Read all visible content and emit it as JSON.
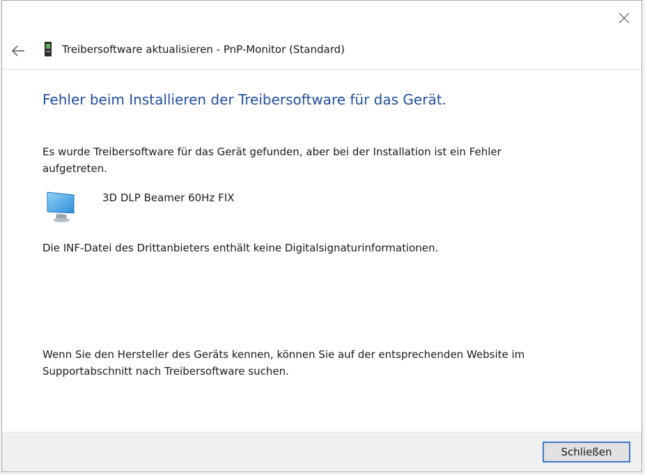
{
  "header": {
    "title": "Treibersoftware aktualisieren - PnP-Monitor (Standard)"
  },
  "content": {
    "heading": "Fehler beim Installieren der Treibersoftware für das Gerät.",
    "message": "Es wurde Treibersoftware für das Gerät gefunden, aber bei der Installation ist ein Fehler aufgetreten.",
    "device_name": "3D DLP Beamer 60Hz FIX",
    "detail": "Die INF-Datei des Drittanbieters enthält keine Digitalsignaturinformationen.",
    "hint": "Wenn Sie den Hersteller des Geräts kennen, können Sie auf der entsprechenden Website im Supportabschnitt nach Treibersoftware suchen."
  },
  "footer": {
    "close_label": "Schließen"
  },
  "colors": {
    "heading": "#1f4e9c",
    "button_border": "#3b78c7",
    "footer_bg": "#f0f0f0"
  },
  "icons": {
    "close": "close-icon",
    "back": "back-arrow-icon",
    "device": "device-icon",
    "monitor": "monitor-icon"
  }
}
